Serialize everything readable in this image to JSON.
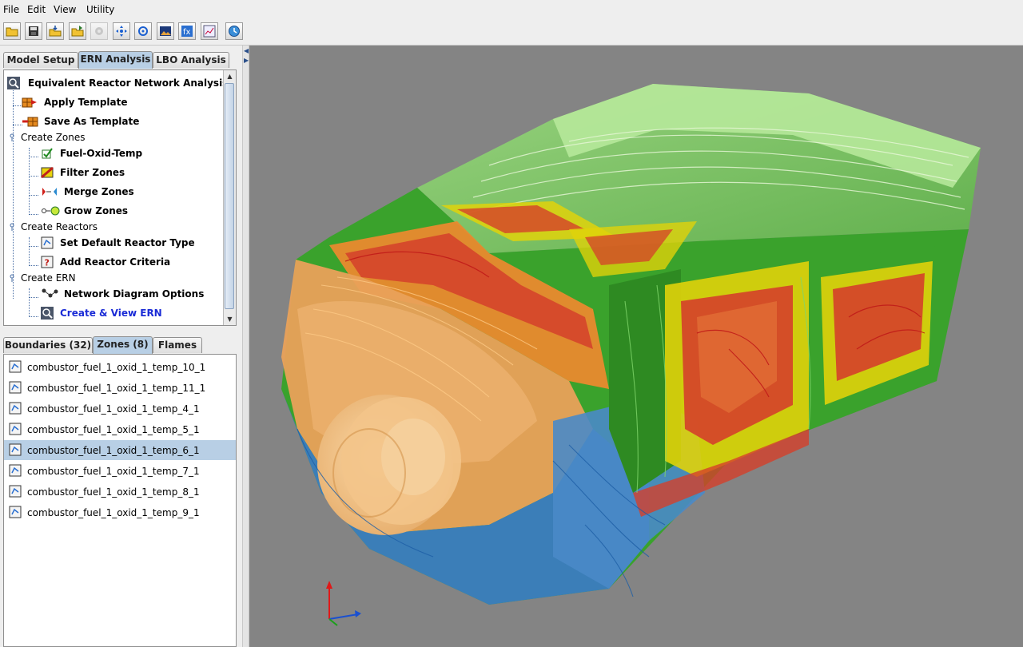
{
  "menu": [
    "File",
    "Edit",
    "View",
    "Utility"
  ],
  "toolbar": {
    "buttons": [
      {
        "name": "open-folder-icon",
        "disabled": false
      },
      {
        "name": "save-icon",
        "disabled": false
      },
      {
        "name": "import-icon",
        "disabled": false
      },
      {
        "name": "open-project-icon",
        "disabled": false
      },
      {
        "name": "settings-disabled-icon",
        "disabled": true
      },
      {
        "name": "move-tool-icon",
        "disabled": false
      },
      {
        "name": "rotate-tool-icon",
        "disabled": false
      },
      {
        "name": "image-icon",
        "disabled": false
      },
      {
        "name": "function-icon",
        "disabled": false
      },
      {
        "name": "chart-icon",
        "disabled": false
      },
      {
        "name": "clock-icon",
        "disabled": false
      }
    ]
  },
  "top_tabs": [
    "Model Setup",
    "ERN Analysis",
    "LBO Analysis"
  ],
  "top_tabs_active": 1,
  "tree": {
    "root": "Equivalent Reactor Network Analysis",
    "apply_template": "Apply Template",
    "save_template": "Save As Template",
    "create_zones": "Create Zones",
    "fuel_oxid_temp": "Fuel-Oxid-Temp",
    "filter_zones": "Filter Zones",
    "merge_zones": "Merge Zones",
    "grow_zones": "Grow Zones",
    "create_reactors": "Create Reactors",
    "set_default": "Set Default Reactor Type",
    "add_criteria": "Add Reactor Criteria",
    "create_ern": "Create ERN",
    "network_options": "Network Diagram Options",
    "create_view": "Create & View ERN"
  },
  "bottom_tabs": [
    "Boundaries (32)",
    "Zones (8)",
    "Flames"
  ],
  "bottom_tabs_active": 1,
  "zones": [
    "combustor_fuel_1_oxid_1_temp_10_1",
    "combustor_fuel_1_oxid_1_temp_11_1",
    "combustor_fuel_1_oxid_1_temp_4_1",
    "combustor_fuel_1_oxid_1_temp_5_1",
    "combustor_fuel_1_oxid_1_temp_6_1",
    "combustor_fuel_1_oxid_1_temp_7_1",
    "combustor_fuel_1_oxid_1_temp_8_1",
    "combustor_fuel_1_oxid_1_temp_9_1"
  ],
  "zones_selected": 4,
  "colors": {
    "viewport_bg": "#848484",
    "selection": "#b8cfe5",
    "link_text": "#1a2bd6",
    "zone_green": "#3aa22c",
    "zone_light_green": "#b6e89a",
    "zone_yellow": "#e0d20a",
    "zone_red": "#d4402a",
    "zone_orange": "#e98a2e",
    "zone_blue": "#3b7cc0",
    "swirler": "#f3c48a"
  }
}
